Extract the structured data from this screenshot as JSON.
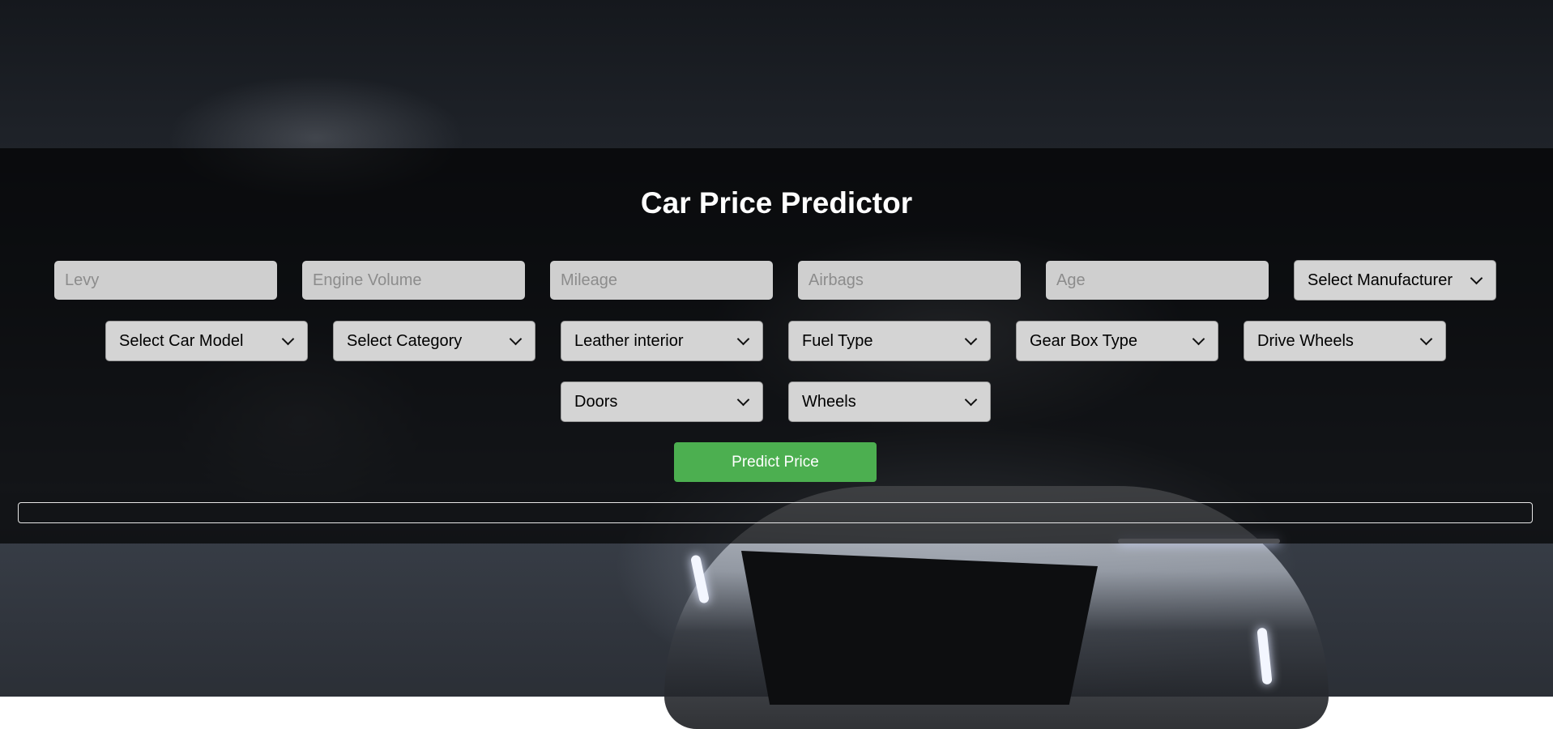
{
  "app": {
    "title": "Car Price Predictor"
  },
  "form": {
    "inputs": [
      {
        "placeholder": "Levy",
        "value": ""
      },
      {
        "placeholder": "Engine Volume",
        "value": ""
      },
      {
        "placeholder": "Mileage",
        "value": ""
      },
      {
        "placeholder": "Airbags",
        "value": ""
      },
      {
        "placeholder": "Age",
        "value": ""
      }
    ],
    "selects": {
      "manufacturer": "Select Manufacturer",
      "car_model": "Select Car Model",
      "category": "Select Category",
      "leather_interior": "Leather interior",
      "fuel_type": "Fuel Type",
      "gear_box_type": "Gear Box Type",
      "drive_wheels": "Drive Wheels",
      "doors": "Doors",
      "wheels": "Wheels"
    },
    "predict_label": "Predict Price",
    "result_text": ""
  },
  "colors": {
    "accent": "#4caf50",
    "field_bg": "#cfcfcf",
    "overlay": "rgba(0,0,0,0.68)"
  },
  "icons": {
    "select_arrow": "chevron-down-icon"
  }
}
